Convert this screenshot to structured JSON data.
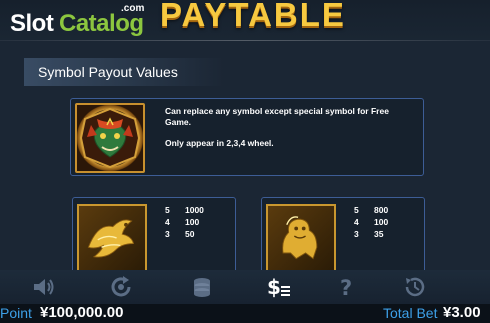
{
  "logo": {
    "slot": "Slot",
    "catalog": "Catalog",
    "com": ".com"
  },
  "title": "PAYTABLE",
  "section": {
    "header": "Symbol Payout Values"
  },
  "wild_card": {
    "symbol_icon": "dragon-wild-icon",
    "line1": "Can replace any symbol except special symbol for Free Game.",
    "line2": "Only appear in 2,3,4 wheel."
  },
  "phoenix_card": {
    "symbol_icon": "golden-phoenix-icon",
    "payouts": [
      {
        "count": "5",
        "value": "1000"
      },
      {
        "count": "4",
        "value": "100"
      },
      {
        "count": "3",
        "value": "50"
      }
    ]
  },
  "lion_card": {
    "symbol_icon": "golden-lion-icon",
    "payouts": [
      {
        "count": "5",
        "value": "800"
      },
      {
        "count": "4",
        "value": "100"
      },
      {
        "count": "3",
        "value": "35"
      }
    ]
  },
  "controls": [
    {
      "name": "sound-icon"
    },
    {
      "name": "autospin-icon"
    },
    {
      "name": "coins-icon"
    },
    {
      "name": "paytable-icon",
      "active": true
    },
    {
      "name": "help-icon"
    },
    {
      "name": "history-icon"
    }
  ],
  "status": {
    "point_label": "Point",
    "point_value": "¥100,000.00",
    "bet_label": "Total Bet",
    "bet_value": "¥3.00"
  },
  "colors": {
    "title": "#f7c940",
    "card_border": "#3d5d96",
    "status_label": "#3da0e8",
    "logo_green": "#8cc63f"
  }
}
